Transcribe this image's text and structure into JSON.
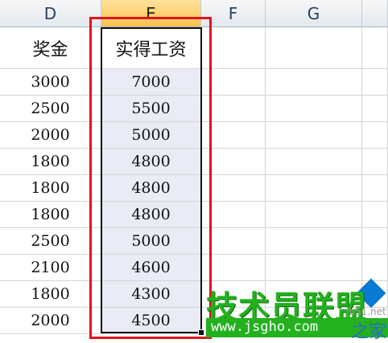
{
  "columns": [
    "D",
    "E",
    "F",
    "G"
  ],
  "header_row": {
    "d": "奖金",
    "e": "实得工资"
  },
  "rows": [
    {
      "d": "3000",
      "e": "7000"
    },
    {
      "d": "2500",
      "e": "5500"
    },
    {
      "d": "2000",
      "e": "5000"
    },
    {
      "d": "1800",
      "e": "4800"
    },
    {
      "d": "1800",
      "e": "4800"
    },
    {
      "d": "1800",
      "e": "4800"
    },
    {
      "d": "2500",
      "e": "5000"
    },
    {
      "d": "2100",
      "e": "4600"
    },
    {
      "d": "1800",
      "e": "4300"
    },
    {
      "d": "2000",
      "e": "4500"
    }
  ],
  "watermark": {
    "brand": "技术员联盟",
    "url": "www.jsgho.com",
    "tail": "之家",
    "small": "jb51.net"
  },
  "colors": {
    "selection_border": "#111111",
    "annotation_red": "#e0141e",
    "header_active": "#f8c24f",
    "watermark_green": "#23b11d"
  }
}
